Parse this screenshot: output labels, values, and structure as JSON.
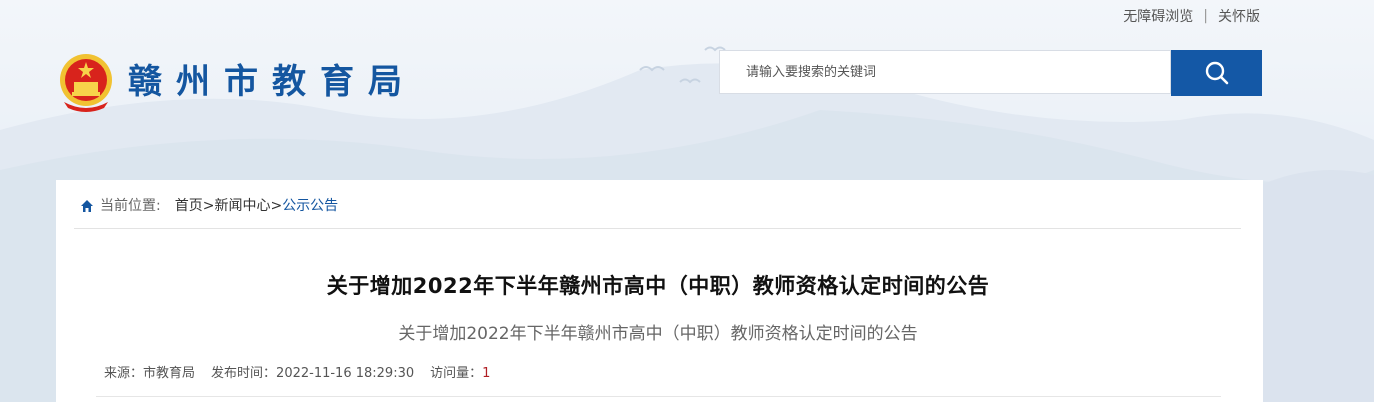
{
  "top_links": {
    "accessible": "无障碍浏览",
    "separator": "|",
    "care": "关怀版"
  },
  "header": {
    "site_title": "赣州市教育局",
    "emblem": "national-emblem-icon"
  },
  "search": {
    "placeholder": "请输入要搜索的关键词",
    "button_icon": "search-icon"
  },
  "breadcrumb": {
    "label": "当前位置:",
    "items": [
      "首页",
      "新闻中心",
      "公示公告"
    ],
    "separator": ">"
  },
  "article": {
    "title": "关于增加2022年下半年赣州市高中（中职）教师资格认定时间的公告",
    "subtitle": "关于增加2022年下半年赣州市高中（中职）教师资格认定时间的公告",
    "source_label": "来源：",
    "source": "市教育局",
    "date_label": "发布时间：",
    "date": "2022-11-16 18:29:30",
    "views_label": "访问量：",
    "views": "1"
  },
  "colors": {
    "brand": "#1456a0",
    "search_button": "#1458a6",
    "views": "#b01f24"
  }
}
